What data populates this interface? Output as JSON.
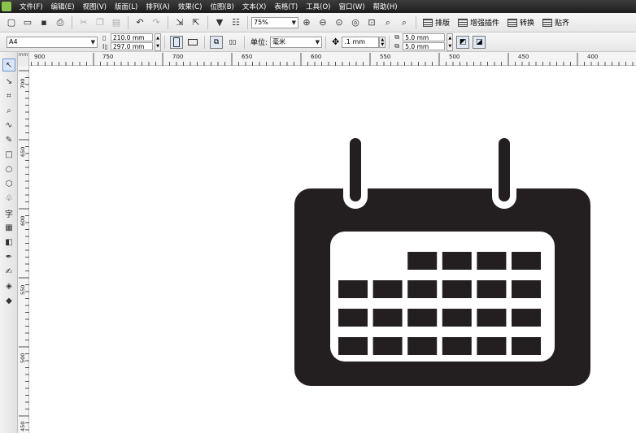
{
  "menubar": {
    "items": [
      "文件(F)",
      "编辑(E)",
      "视图(V)",
      "版面(L)",
      "排列(A)",
      "效果(C)",
      "位图(B)",
      "文本(X)",
      "表格(T)",
      "工具(O)",
      "窗口(W)",
      "帮助(H)"
    ]
  },
  "toolbar_main": {
    "zoom": "75%",
    "buttons": [
      "排版",
      "增强插件",
      "转换",
      "贴齐"
    ]
  },
  "property_bar": {
    "page_size": "A4",
    "width": "210.0 mm",
    "height": "297.0 mm",
    "unit_label": "单位:",
    "unit_value": "毫米",
    "nudge": ".1 mm",
    "dup_x": "5.0 mm",
    "dup_y": "5.0 mm"
  },
  "ruler": {
    "top_labels": [
      "900",
      "750",
      "700",
      "650",
      "600",
      "550",
      "500",
      "450",
      "400"
    ],
    "left_labels": [
      "700",
      "650",
      "600",
      "550",
      "500",
      "450"
    ],
    "corner": "mm"
  },
  "calendar_icon": {
    "fill": "#231f20",
    "rows": 4,
    "cols": 6,
    "first_row_start_col": 2
  },
  "colors": {
    "menubar": "#2b2b2b",
    "toolbar": "#ececec",
    "icon": "#231f20"
  }
}
